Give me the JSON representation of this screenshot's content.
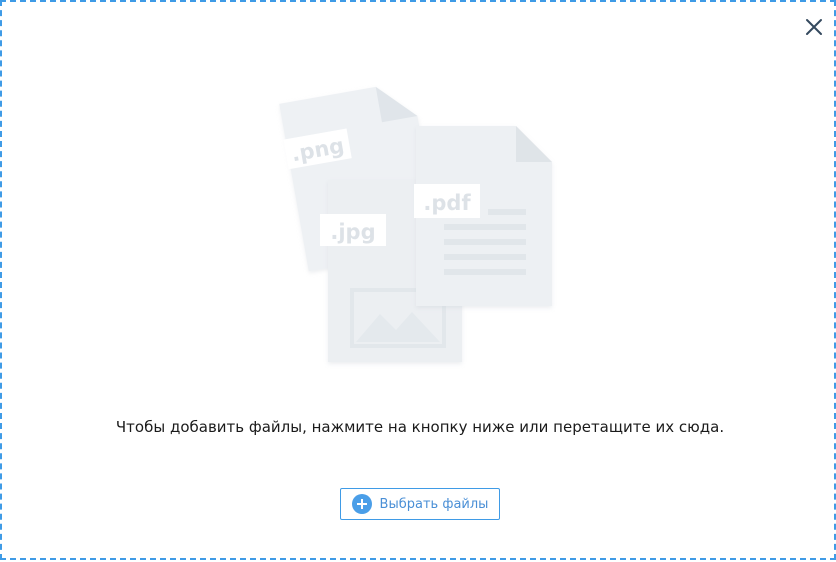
{
  "dropzone": {
    "hint": "Чтобы добавить файлы, нажмите на кнопку ниже или перетащите их сюда.",
    "select_button_label": "Выбрать файлы",
    "close_icon": "close-icon",
    "plus_icon": "plus-circle-icon"
  },
  "illustration": {
    "png_label": ".png",
    "jpg_label": ".jpg",
    "pdf_label": ".pdf"
  },
  "colors": {
    "accent": "#3f9be6",
    "doc_fill": "#eceff2",
    "doc_fold": "#dfe4e8",
    "text": "#1b1b1b"
  }
}
